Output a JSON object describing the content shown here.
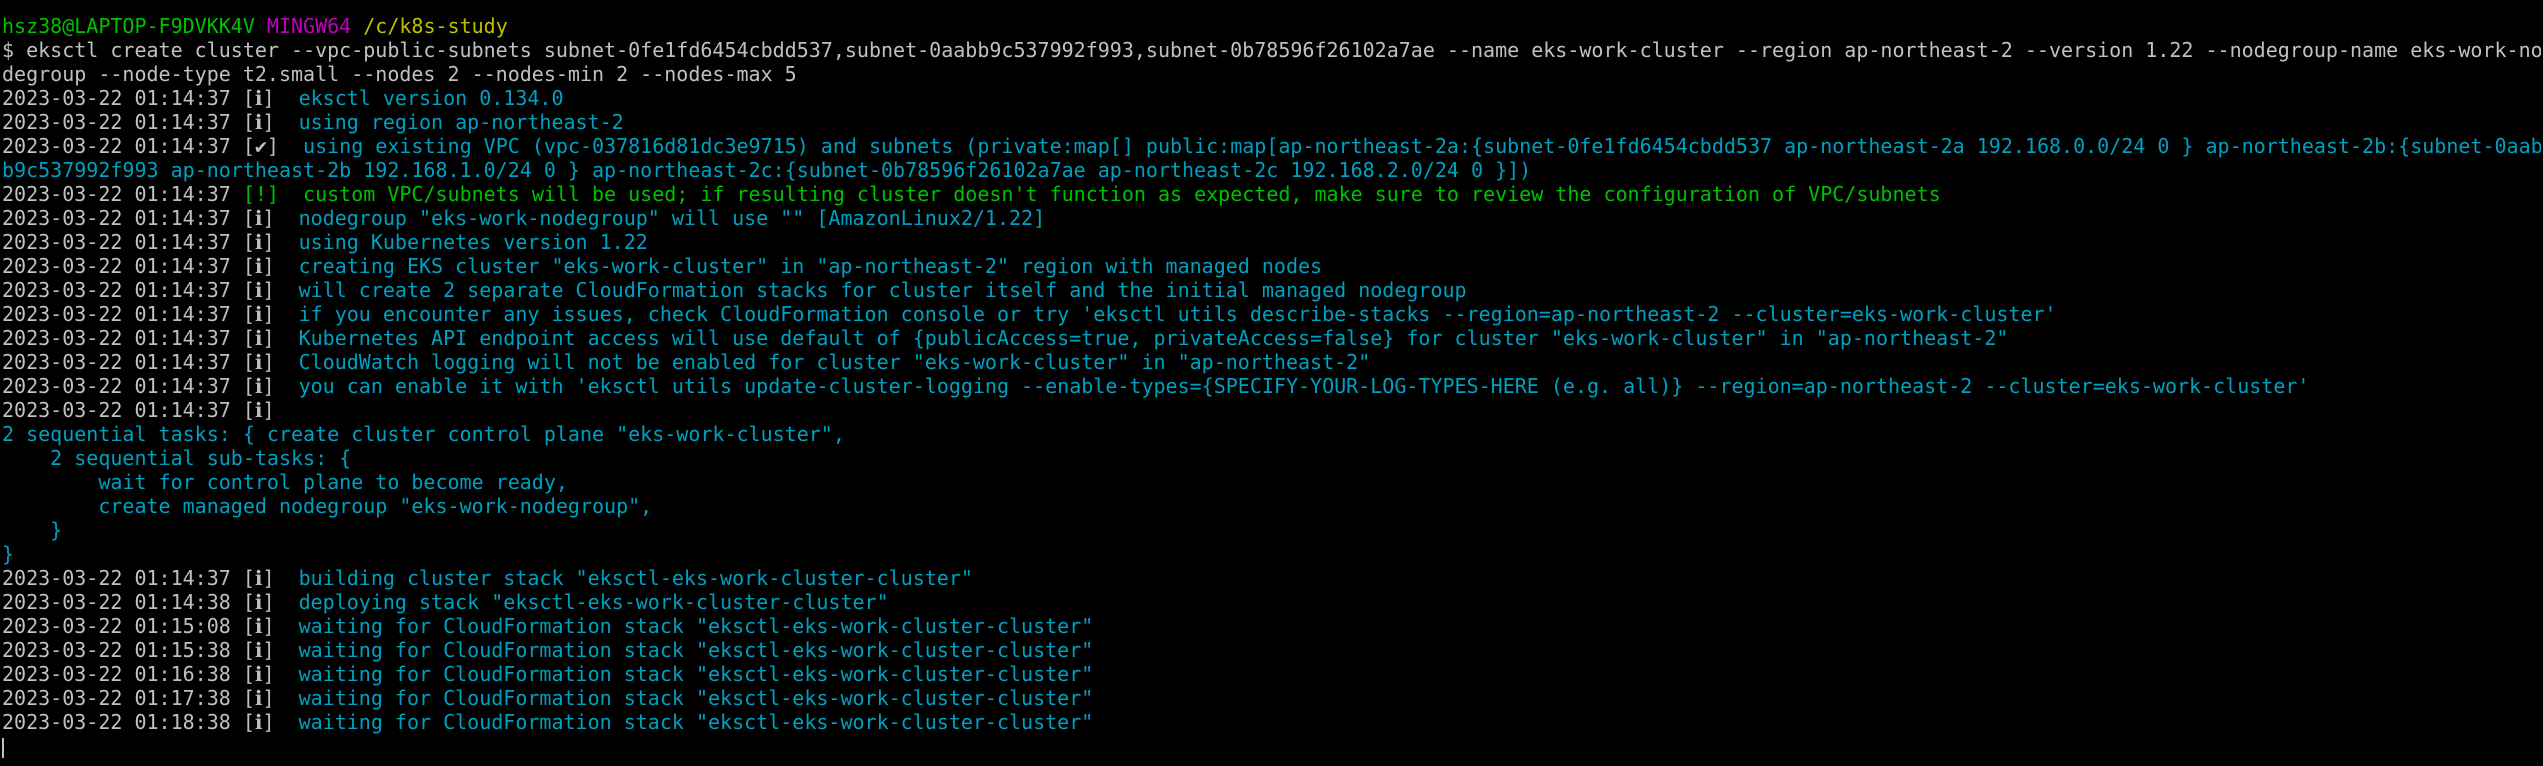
{
  "prompt": {
    "user_host": "hsz38@LAPTOP-F9DVKK4V",
    "shell": "MINGW64",
    "cwd": "/c/k8s-study"
  },
  "command": {
    "line1": "$ eksctl create cluster --vpc-public-subnets subnet-0fe1fd6454cbdd537,subnet-0aabb9c537992f993,subnet-0b78596f26102a7ae --name eks-work-cluster --region ap-northeast-2 --version 1.22 --nodegroup-name eks-work-no",
    "line2": "degroup --node-type t2.small --nodes 2 --nodes-min 2 --nodes-max 5"
  },
  "log": [
    {
      "ts": "2023-03-22 01:14:37",
      "tag": "[ℹ]",
      "msg": "  eksctl version 0.134.0",
      "color": "cyan"
    },
    {
      "ts": "2023-03-22 01:14:37",
      "tag": "[ℹ]",
      "msg": "  using region ap-northeast-2",
      "color": "cyan"
    },
    {
      "ts": "2023-03-22 01:14:37",
      "tag": "[✔]",
      "msg": "  using existing VPC (vpc-037816d81dc3e9715) and subnets (private:map[] public:map[ap-northeast-2a:{subnet-0fe1fd6454cbdd537 ap-northeast-2a 192.168.0.0/24 0 } ap-northeast-2b:{subnet-0aab",
      "color": "cyan"
    },
    {
      "ts": "",
      "tag": "",
      "msg": "b9c537992f993 ap-northeast-2b 192.168.1.0/24 0 } ap-northeast-2c:{subnet-0b78596f26102a7ae ap-northeast-2c 192.168.2.0/24 0 }])",
      "color": "cyan"
    },
    {
      "ts": "2023-03-22 01:14:37",
      "tag": "[!]",
      "msg": "  custom VPC/subnets will be used; if resulting cluster doesn't function as expected, make sure to review the configuration of VPC/subnets",
      "color": "green"
    },
    {
      "ts": "2023-03-22 01:14:37",
      "tag": "[ℹ]",
      "msg": "  nodegroup \"eks-work-nodegroup\" will use \"\" [AmazonLinux2/1.22]",
      "color": "cyan"
    },
    {
      "ts": "2023-03-22 01:14:37",
      "tag": "[ℹ]",
      "msg": "  using Kubernetes version 1.22",
      "color": "cyan"
    },
    {
      "ts": "2023-03-22 01:14:37",
      "tag": "[ℹ]",
      "msg": "  creating EKS cluster \"eks-work-cluster\" in \"ap-northeast-2\" region with managed nodes",
      "color": "cyan"
    },
    {
      "ts": "2023-03-22 01:14:37",
      "tag": "[ℹ]",
      "msg": "  will create 2 separate CloudFormation stacks for cluster itself and the initial managed nodegroup",
      "color": "cyan"
    },
    {
      "ts": "2023-03-22 01:14:37",
      "tag": "[ℹ]",
      "msg": "  if you encounter any issues, check CloudFormation console or try 'eksctl utils describe-stacks --region=ap-northeast-2 --cluster=eks-work-cluster'",
      "color": "cyan"
    },
    {
      "ts": "2023-03-22 01:14:37",
      "tag": "[ℹ]",
      "msg": "  Kubernetes API endpoint access will use default of {publicAccess=true, privateAccess=false} for cluster \"eks-work-cluster\" in \"ap-northeast-2\"",
      "color": "cyan"
    },
    {
      "ts": "2023-03-22 01:14:37",
      "tag": "[ℹ]",
      "msg": "  CloudWatch logging will not be enabled for cluster \"eks-work-cluster\" in \"ap-northeast-2\"",
      "color": "cyan"
    },
    {
      "ts": "2023-03-22 01:14:37",
      "tag": "[ℹ]",
      "msg": "  you can enable it with 'eksctl utils update-cluster-logging --enable-types={SPECIFY-YOUR-LOG-TYPES-HERE (e.g. all)} --region=ap-northeast-2 --cluster=eks-work-cluster'",
      "color": "cyan"
    },
    {
      "ts": "2023-03-22 01:14:37",
      "tag": "[ℹ]",
      "msg": "",
      "color": "cyan"
    },
    {
      "ts": "",
      "tag": "",
      "msg": "2 sequential tasks: { create cluster control plane \"eks-work-cluster\",",
      "color": "cyan"
    },
    {
      "ts": "",
      "tag": "",
      "msg": "    2 sequential sub-tasks: {",
      "color": "cyan"
    },
    {
      "ts": "",
      "tag": "",
      "msg": "        wait for control plane to become ready,",
      "color": "cyan"
    },
    {
      "ts": "",
      "tag": "",
      "msg": "        create managed nodegroup \"eks-work-nodegroup\",",
      "color": "cyan"
    },
    {
      "ts": "",
      "tag": "",
      "msg": "    }",
      "color": "cyan"
    },
    {
      "ts": "",
      "tag": "",
      "msg": "}",
      "color": "cyan"
    },
    {
      "ts": "2023-03-22 01:14:37",
      "tag": "[ℹ]",
      "msg": "  building cluster stack \"eksctl-eks-work-cluster-cluster\"",
      "color": "cyan"
    },
    {
      "ts": "2023-03-22 01:14:38",
      "tag": "[ℹ]",
      "msg": "  deploying stack \"eksctl-eks-work-cluster-cluster\"",
      "color": "cyan"
    },
    {
      "ts": "2023-03-22 01:15:08",
      "tag": "[ℹ]",
      "msg": "  waiting for CloudFormation stack \"eksctl-eks-work-cluster-cluster\"",
      "color": "cyan"
    },
    {
      "ts": "2023-03-22 01:15:38",
      "tag": "[ℹ]",
      "msg": "  waiting for CloudFormation stack \"eksctl-eks-work-cluster-cluster\"",
      "color": "cyan"
    },
    {
      "ts": "2023-03-22 01:16:38",
      "tag": "[ℹ]",
      "msg": "  waiting for CloudFormation stack \"eksctl-eks-work-cluster-cluster\"",
      "color": "cyan"
    },
    {
      "ts": "2023-03-22 01:17:38",
      "tag": "[ℹ]",
      "msg": "  waiting for CloudFormation stack \"eksctl-eks-work-cluster-cluster\"",
      "color": "cyan"
    },
    {
      "ts": "2023-03-22 01:18:38",
      "tag": "[ℹ]",
      "msg": "  waiting for CloudFormation stack \"eksctl-eks-work-cluster-cluster\"",
      "color": "cyan"
    }
  ],
  "colors": {
    "background": "#000000",
    "user": "#00c000",
    "shell": "#c000c0",
    "path": "#c0c000",
    "info": "#00a0c0",
    "warning": "#00c000",
    "text": "#c0c0c0"
  }
}
